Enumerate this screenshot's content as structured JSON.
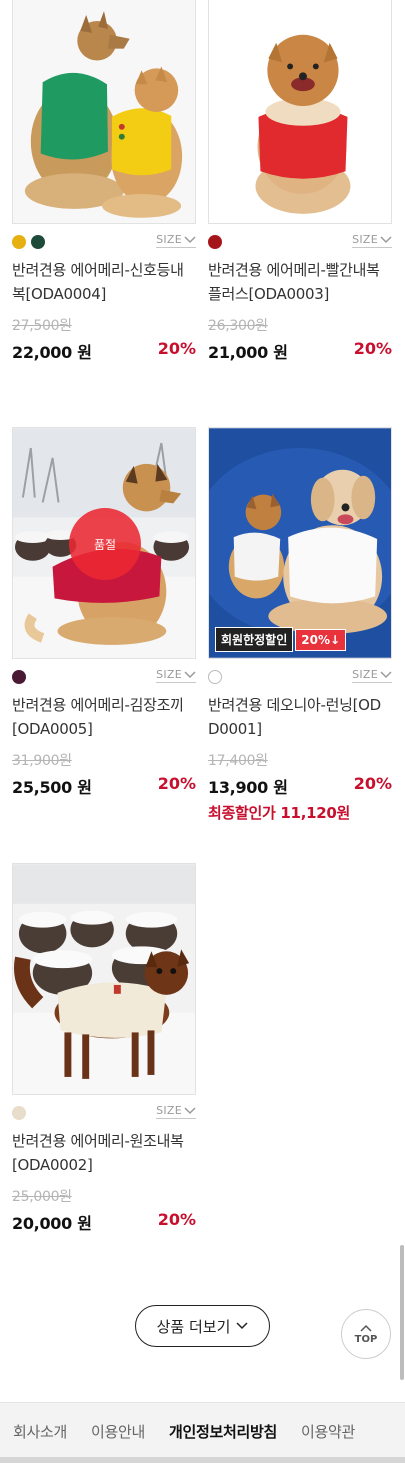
{
  "products": [
    {
      "name": "반려견용 에어메리-신호등내복[ODA0004]",
      "colors": [
        "#e6b012",
        "#1e4a3a"
      ],
      "size_label": "SIZE",
      "original_price": "27,500원",
      "price": "22,000 원",
      "discount_rate": "20%",
      "image": "dogs-green-yellow-shirts"
    },
    {
      "name": "반려견용 에어메리-빨간내복플러스[ODA0003]",
      "colors": [
        "#a5161b"
      ],
      "size_label": "SIZE",
      "original_price": "26,300원",
      "price": "21,000 원",
      "discount_rate": "20%",
      "image": "pomeranian-red-shirt"
    },
    {
      "name": "반려견용 에어메리-김장조끼[ODA0005]",
      "colors": [
        "#4a1a35"
      ],
      "size_label": "SIZE",
      "original_price": "31,900원",
      "price": "25,500 원",
      "discount_rate": "20%",
      "soldout_label": "품절",
      "image": "dog-red-vest-snow"
    },
    {
      "name": "반려견용 데오니아-런닝[ODD0001]",
      "colors": [
        "#ffffff"
      ],
      "size_label": "SIZE",
      "original_price": "17,400원",
      "price": "13,900 원",
      "discount_rate": "20%",
      "final_price": "최종할인가 11,120원",
      "promo_label": "회원한정할인",
      "promo_rate": "20%↓",
      "image": "dogs-white-running-shirts-blue"
    },
    {
      "name": "반려견용 에어메리-원조내복[ODA0002]",
      "colors": [
        "#e8dccb"
      ],
      "size_label": "SIZE",
      "original_price": "25,000원",
      "price": "20,000 원",
      "discount_rate": "20%",
      "image": "chihuahua-cream-shirt-snow"
    }
  ],
  "more_button": {
    "label": "상품 더보기",
    "icon": "chevron-down-icon"
  },
  "top_button": {
    "label": "TOP",
    "icon": "chevron-up-icon"
  },
  "footer_nav": [
    "회사소개",
    "이용안내",
    "개인정보처리방침",
    "이용약관"
  ],
  "footer_active": "개인정보처리방침",
  "colors": {
    "accent_red": "#c8102e",
    "sold_out": "#eb2832"
  }
}
